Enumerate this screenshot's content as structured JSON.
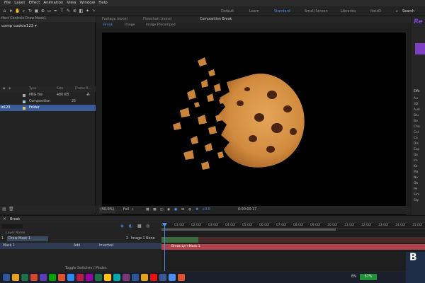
{
  "menu": [
    "File",
    "Layer",
    "Effect",
    "Animation",
    "View",
    "Window",
    "Help"
  ],
  "workspaces": [
    {
      "label": "Default",
      "active": false
    },
    {
      "label": "Learn",
      "active": false
    },
    {
      "label": "Standard",
      "active": true
    },
    {
      "label": "Small Screen",
      "active": false
    },
    {
      "label": "Libraries",
      "active": false
    },
    {
      "label": "ikeid3",
      "active": false
    }
  ],
  "search_label": "Search",
  "left_panel": {
    "tab": "ffect Controls Draw Mask1",
    "comp_name": "comp cookie123 ▾",
    "columns": [
      "Type",
      "Size",
      "Frame R..."
    ],
    "rows": [
      {
        "name": "",
        "type": "PNG file",
        "size": "480 KB",
        "extra": "",
        "color": "#a8a8a8",
        "selected": false
      },
      {
        "name": "",
        "type": "Composition",
        "size": "",
        "extra": "25",
        "color": "#a7c8d9",
        "selected": false
      },
      {
        "name": "ie123",
        "type": "Folder",
        "size": "",
        "extra": "",
        "color": "#e3c65a",
        "selected": true
      }
    ]
  },
  "comp_panel": {
    "tabs": [
      {
        "label": "Footage (none)",
        "active": false
      },
      {
        "label": "Flowchart (none)",
        "active": false
      },
      {
        "label": "Composition Break",
        "active": true
      }
    ],
    "subtabs": [
      {
        "label": "Break",
        "active": true
      },
      {
        "label": "Image",
        "active": false
      },
      {
        "label": "Image Precomped",
        "active": false
      }
    ],
    "zoom": "(50.0%)",
    "resolution": "Full",
    "timecode": "0:00:00:17",
    "exposure": "+0.0"
  },
  "right_panel": {
    "badge": "Re",
    "effects": [
      "Effe",
      "Au",
      "3D",
      "Aud",
      "Blu",
      "Bo",
      "Cha",
      "Col",
      "Co",
      "Dis",
      "Exp",
      "Ge",
      "Im",
      "Ke",
      "Ma",
      "No",
      "Ob",
      "Pe",
      "Sim",
      "Sty"
    ]
  },
  "timeline": {
    "tab": "Break",
    "ticks": [
      "0f",
      "01:00f",
      "02:00f",
      "03:00f",
      "04:00f",
      "05:00f",
      "06:00f",
      "07:00f",
      "08:00f",
      "09:00f",
      "10:00f",
      "11:00f",
      "12:00f",
      "13:00f",
      "14:00f",
      "15:00f"
    ],
    "layer_header": "Layer Name",
    "layers": [
      {
        "num": "1",
        "name": "Draw Mask 1",
        "parent": "None"
      },
      {
        "num": "2",
        "name": "Image 1",
        "parent": "None"
      }
    ],
    "mask_name": "Mask 1",
    "mask_mode": "Add",
    "mask_inverted": "Inverted",
    "clip_label": "Break Lyr+Mask 1",
    "toggle_label": "Toggle Switches / Modes"
  },
  "taskbar": {
    "lang": "EN",
    "battery": "57%",
    "icon_colors": [
      "#2b5797",
      "#e3a21a",
      "#1e7145",
      "#d24726",
      "#603cba",
      "#00a300",
      "#da532c",
      "#2d89ef",
      "#b91d47",
      "#9f00a7",
      "#1e7145",
      "#ffc40d",
      "#00aba9",
      "#7e3878",
      "#2b5797",
      "#e3a21a",
      "#ee1111",
      "#3b5b96",
      "#4d8ff0",
      "#da532c"
    ]
  },
  "corner": {
    "label": "B"
  }
}
